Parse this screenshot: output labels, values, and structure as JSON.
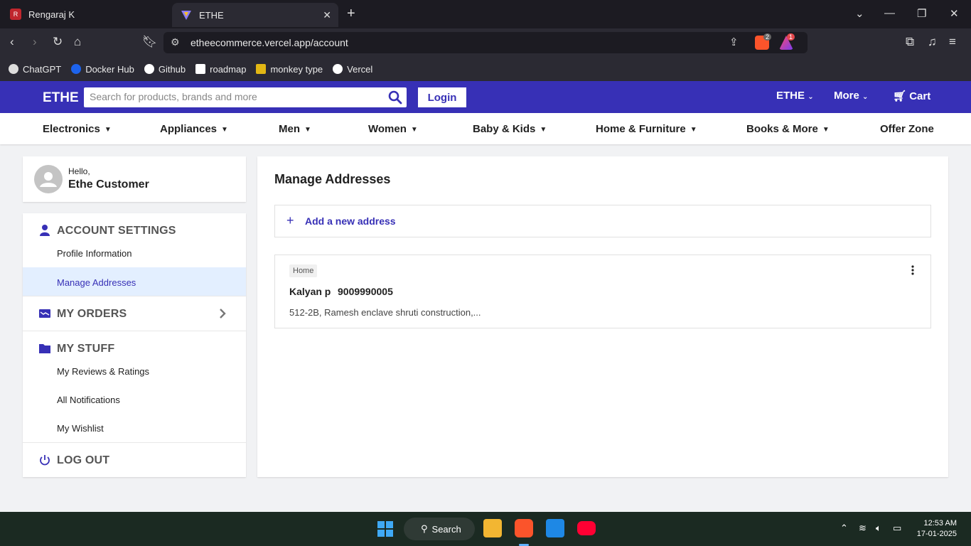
{
  "browser": {
    "tabs": [
      {
        "title": "Rengaraj K",
        "active": false
      },
      {
        "title": "ETHE",
        "active": true
      }
    ],
    "url": "etheecommerce.vercel.app/account",
    "bookmarks": [
      "ChatGPT",
      "Docker Hub",
      "Github",
      "roadmap",
      "monkey type",
      "Vercel"
    ],
    "brave_badge": "2",
    "alert_badge": "1"
  },
  "header": {
    "logo": "ETHE",
    "search_placeholder": "Search for products, brands and more",
    "login_label": "Login",
    "ethe_menu": "ETHE",
    "more_menu": "More",
    "cart_label": "Cart"
  },
  "categories": [
    "Electronics",
    "Appliances",
    "Men",
    "Women",
    "Baby & Kids",
    "Home & Furniture",
    "Books & More",
    "Offer Zone"
  ],
  "sidebar": {
    "hello": "Hello,",
    "user_name": "Ethe Customer",
    "account_settings": "ACCOUNT SETTINGS",
    "profile_information": "Profile Information",
    "manage_addresses": "Manage Addresses",
    "my_orders": "MY ORDERS",
    "my_stuff": "MY STUFF",
    "reviews": "My Reviews & Ratings",
    "notifications": "All Notifications",
    "wishlist": "My Wishlist",
    "logout": "LOG OUT"
  },
  "main": {
    "title": "Manage Addresses",
    "add_new": "Add a new address",
    "address": {
      "tag": "Home",
      "name": "Kalyan p",
      "phone": "9009990005",
      "line": "512-2B, Ramesh enclave shruti construction,..."
    }
  },
  "taskbar": {
    "search_label": "Search",
    "time": "12:53 AM",
    "date": "17-01-2025"
  },
  "colors": {
    "brand": "#3730b6",
    "active_bg": "#e3efff"
  }
}
